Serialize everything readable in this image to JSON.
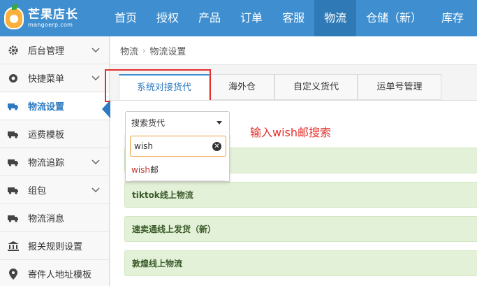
{
  "logo": {
    "title": "芒果店长",
    "subtitle": "mangoerp.com"
  },
  "nav": [
    "首页",
    "授权",
    "产品",
    "订单",
    "客服",
    "物流",
    "仓储（新）",
    "库存"
  ],
  "sidebar": [
    {
      "label": "后台管理",
      "icon": "gear-icon",
      "expandable": true
    },
    {
      "label": "快捷菜单",
      "icon": "circle-icon",
      "expandable": true
    },
    {
      "label": "物流设置",
      "icon": "truck-icon",
      "expandable": false,
      "active": true
    },
    {
      "label": "运费模板",
      "icon": "truck-icon",
      "expandable": false
    },
    {
      "label": "物流追踪",
      "icon": "truck-icon",
      "expandable": true
    },
    {
      "label": "组包",
      "icon": "truck-icon",
      "expandable": true
    },
    {
      "label": "物流消息",
      "icon": "truck-icon",
      "expandable": false
    },
    {
      "label": "报关规则设置",
      "icon": "bank-icon",
      "expandable": false
    },
    {
      "label": "寄件人地址模板",
      "icon": "location-icon",
      "expandable": false
    }
  ],
  "breadcrumb": {
    "parent": "物流",
    "current": "物流设置"
  },
  "tabs": [
    "系统对接货代",
    "海外仓",
    "自定义货代",
    "运单号管理"
  ],
  "forwarder_select": {
    "value": "搜索货代",
    "search_value": "wish",
    "option_match": "wish",
    "option_rest": "邮"
  },
  "carriers": [
    "tiktok线上物流",
    "速卖通线上发货（新）",
    "敦煌线上物流"
  ],
  "annotation": "输入wish邮搜索",
  "colors": {
    "topbar": "#3f8fd0",
    "active_tab": "#2d7ac0",
    "highlight": "#e2302b",
    "row_bg": "#e3f1d8"
  }
}
